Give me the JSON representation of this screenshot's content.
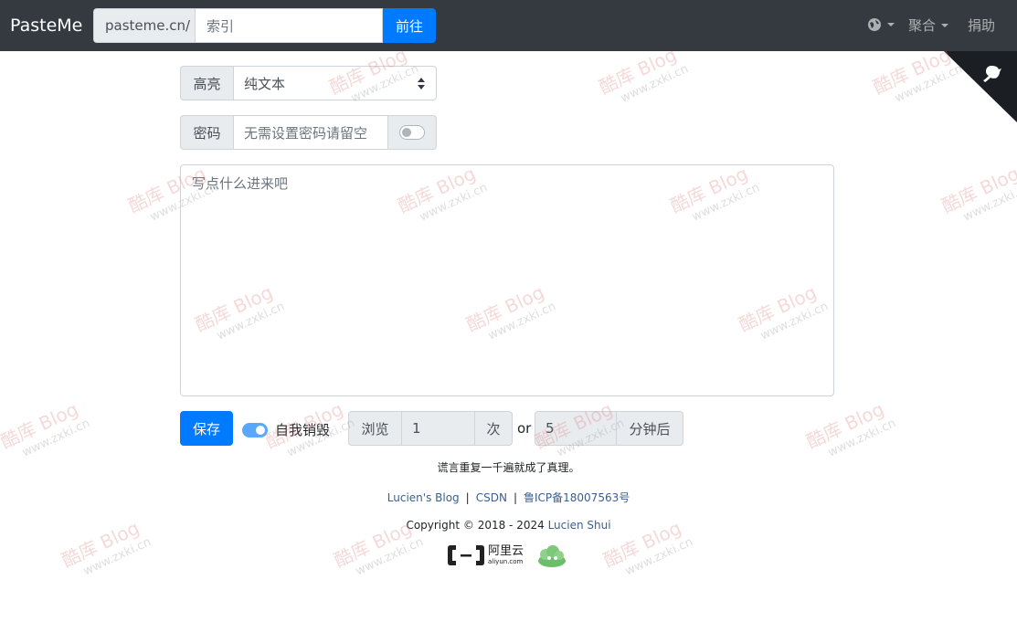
{
  "navbar": {
    "brand": "PasteMe",
    "url_prefix": "pasteme.cn/",
    "search_placeholder": "索引",
    "go_label": "前往",
    "aggregate_label": "聚合",
    "donate_label": "捐助"
  },
  "form": {
    "highlight_label": "高亮",
    "highlight_value": "纯文本",
    "password_label": "密码",
    "password_placeholder": "无需设置密码请留空",
    "content_placeholder": "写点什么进来吧",
    "save_label": "保存",
    "self_destruct_label": "自我销毁",
    "views_label": "浏览",
    "views_value": "1",
    "views_unit": "次",
    "or_label": "or",
    "minutes_value": "5",
    "minutes_unit": "分钟后"
  },
  "footer": {
    "quote": "谎言重复一千遍就成了真理。",
    "links": [
      "Lucien's Blog",
      "CSDN",
      "鲁ICP备18007563号"
    ],
    "copyright_prefix": "Copyright © 2018 - 2024",
    "copyright_author": "Lucien Shui",
    "aliyun_cn": "阿里云",
    "aliyun_en": "aliyun.com"
  },
  "watermark": {
    "title": "酷库 Blog",
    "site": "www.zxki.cn"
  },
  "colors": {
    "navbar": "#343a40",
    "primary": "#007bff",
    "addon_bg": "#e9ecef"
  }
}
